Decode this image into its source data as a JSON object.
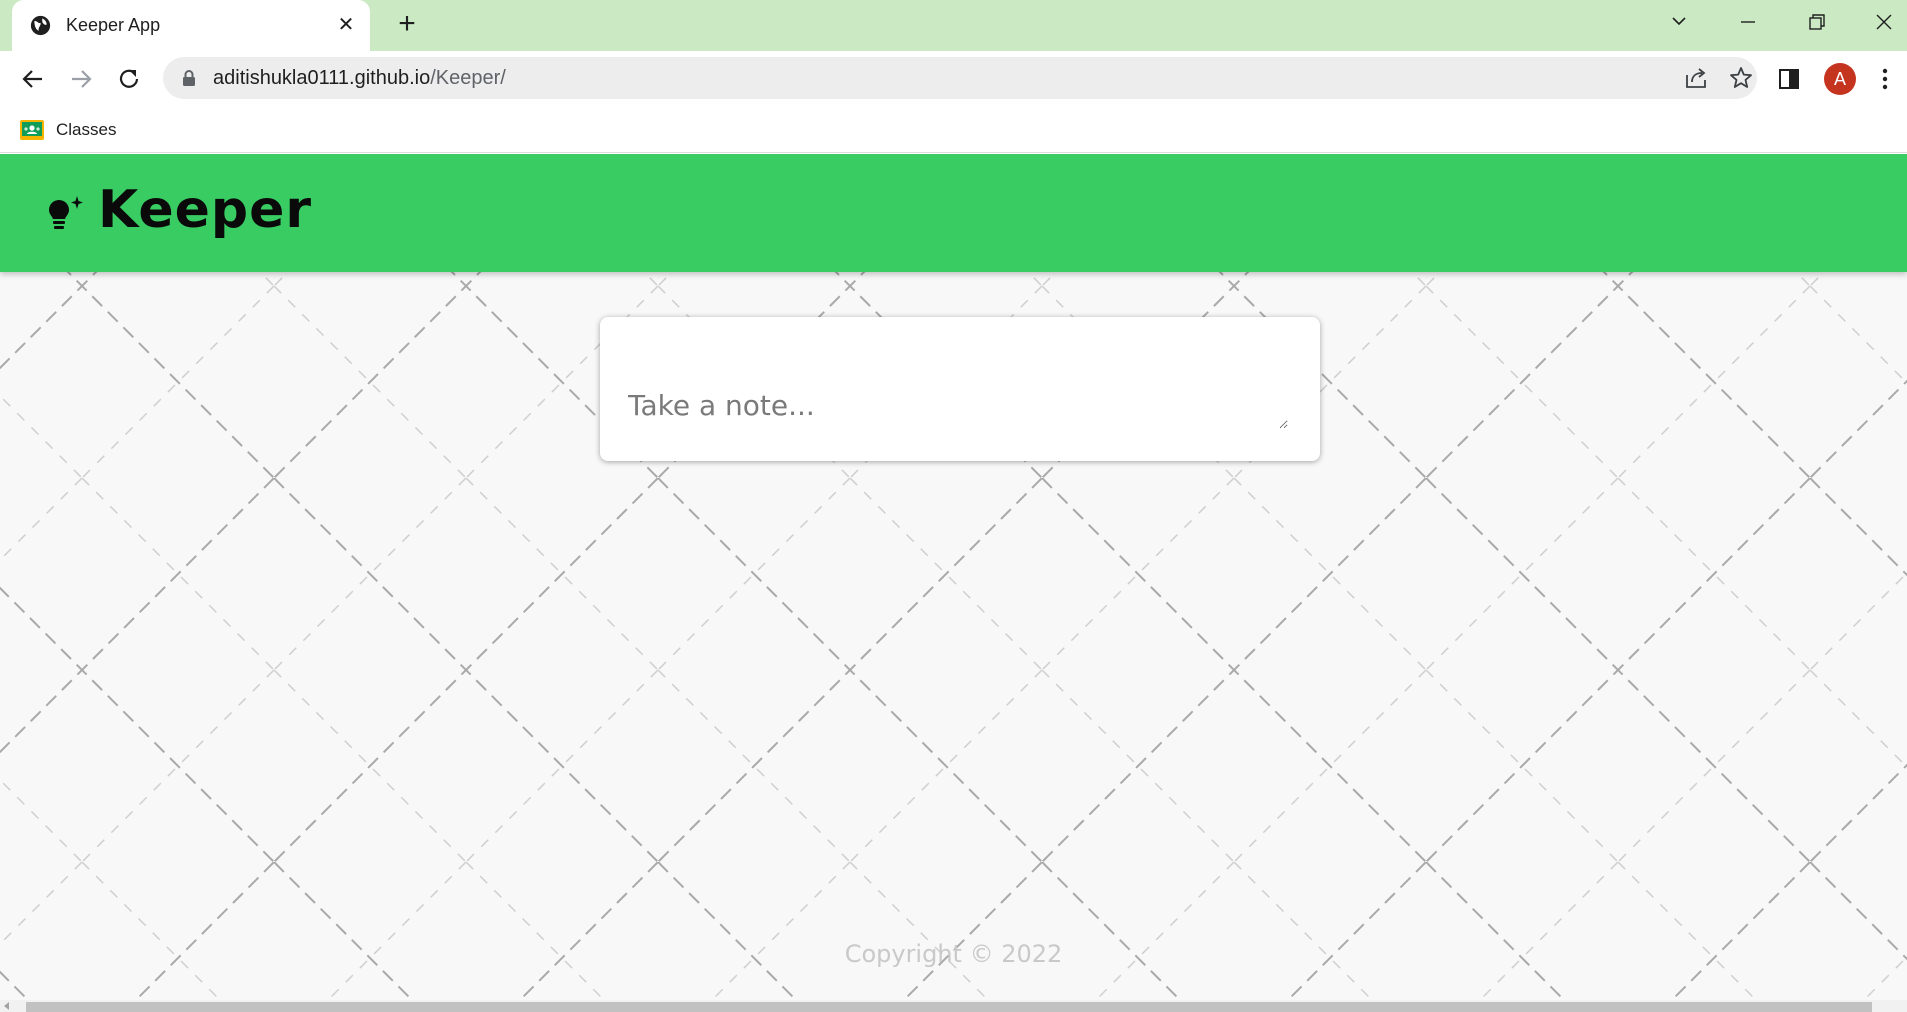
{
  "browser": {
    "tab": {
      "title": "Keeper App"
    },
    "url": {
      "host": "aditishukla0111.github.io",
      "path": "/Keeper/"
    },
    "profile_initial": "A",
    "bookmarks": [
      {
        "label": "Classes"
      }
    ]
  },
  "app": {
    "title": "Keeper",
    "note": {
      "placeholder": "Take a note..."
    },
    "footer": "Copyright © 2022"
  },
  "colors": {
    "header": "#38cc63",
    "tabstrip": "#cbeac3",
    "avatar": "#c5341f"
  }
}
